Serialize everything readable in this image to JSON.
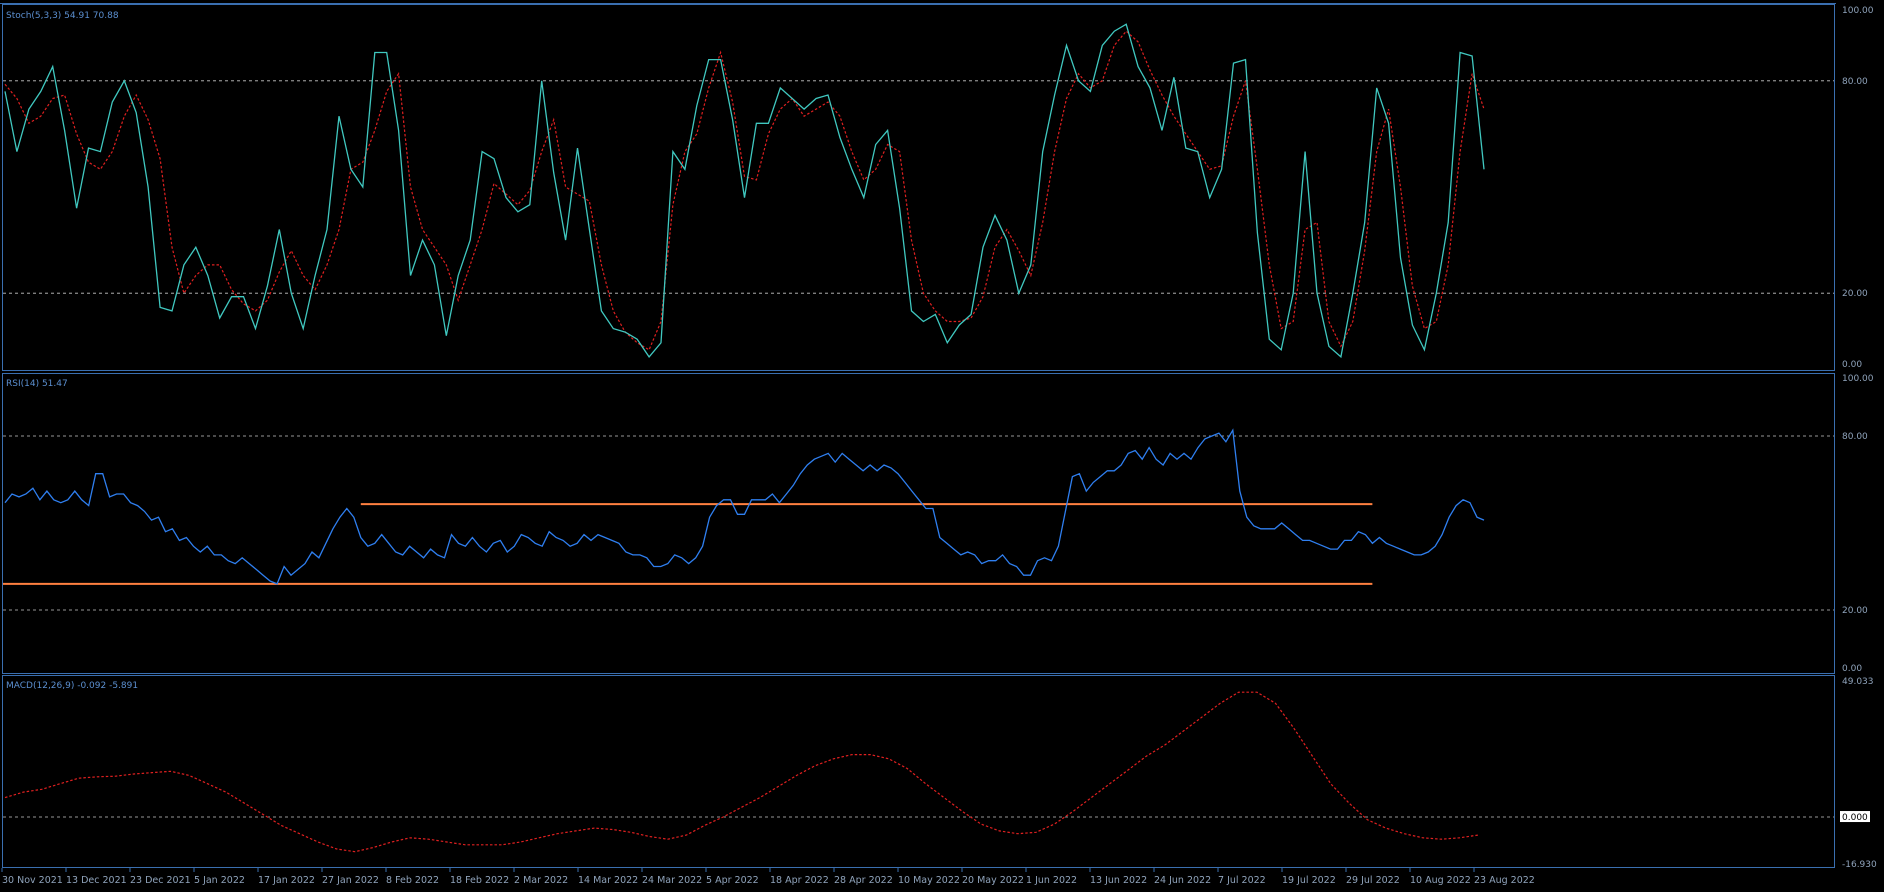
{
  "chart_data": [
    {
      "type": "line",
      "indicator_label": "Stoch(5,3,3) 54.91 70.88",
      "ylim": [
        0,
        100
      ],
      "levels": [
        20,
        80
      ],
      "y_ticks": [
        "100.00",
        "80.00",
        "20.00",
        "0.00"
      ],
      "colors": {
        "main": "#40c8c0",
        "signal": "#e02020",
        "level": "#c8c8c8"
      },
      "series": [
        {
          "values": [
            77,
            60,
            72,
            77,
            84,
            66,
            44,
            61,
            60,
            74,
            80,
            71,
            50,
            16,
            15,
            28,
            33,
            25,
            13,
            19,
            19,
            10,
            22,
            38,
            20,
            10,
            25,
            38,
            70,
            55,
            50,
            88,
            88,
            66,
            25,
            35,
            28,
            8,
            25,
            35,
            60,
            58,
            47,
            43,
            45,
            80,
            54,
            35,
            61,
            38,
            15,
            10,
            9,
            7,
            2,
            6,
            60,
            55,
            73,
            86,
            86,
            69,
            47,
            68,
            68,
            78,
            75,
            72,
            75,
            76,
            64,
            55,
            47,
            62,
            66,
            44,
            15,
            12,
            14,
            6,
            11,
            14,
            33,
            42,
            35,
            20,
            28,
            60,
            76,
            90,
            80,
            77,
            90,
            94,
            96,
            84,
            78,
            66,
            81,
            61,
            60,
            47,
            55,
            85,
            86,
            37,
            7,
            4,
            20,
            60,
            20,
            5,
            2,
            20,
            40,
            78,
            68,
            30,
            11,
            4,
            20,
            40,
            88,
            87,
            55
          ]
        },
        {
          "values": [
            79,
            75,
            68,
            70,
            75,
            76,
            65,
            57,
            55,
            60,
            70,
            76,
            69,
            58,
            33,
            20,
            25,
            28,
            28,
            21,
            17,
            15,
            18,
            26,
            32,
            25,
            21,
            28,
            38,
            55,
            57,
            66,
            77,
            82,
            50,
            38,
            33,
            28,
            18,
            28,
            38,
            51,
            48,
            45,
            49,
            60,
            69,
            50,
            48,
            46,
            28,
            15,
            9,
            6,
            4,
            12,
            45,
            60,
            65,
            78,
            88,
            74,
            53,
            52,
            65,
            72,
            75,
            70,
            72,
            74,
            70,
            60,
            52,
            55,
            62,
            60,
            35,
            20,
            15,
            12,
            12,
            13,
            19,
            33,
            38,
            32,
            25,
            40,
            60,
            75,
            82,
            78,
            80,
            90,
            94,
            91,
            83,
            76,
            70,
            65,
            60,
            55,
            56,
            70,
            80,
            55,
            28,
            10,
            12,
            38,
            40,
            12,
            5,
            12,
            32,
            60,
            72,
            50,
            22,
            10,
            12,
            28,
            60,
            82,
            72
          ]
        }
      ]
    },
    {
      "type": "line",
      "indicator_label": "RSI(14) 51.47",
      "ylim": [
        0,
        100
      ],
      "levels": [
        20,
        80
      ],
      "y_ticks": [
        "100.00",
        "80.00",
        "20.00",
        "0.00"
      ],
      "colors": {
        "main": "#2f7ff0",
        "trendline": "#ff8040",
        "level": "#c8c8c8"
      },
      "series": [
        {
          "values": [
            57,
            60,
            59,
            60,
            62,
            58,
            61,
            58,
            57,
            58,
            61,
            58,
            56,
            67,
            67,
            59,
            60,
            60,
            57,
            56,
            54,
            51,
            52,
            47,
            48,
            44,
            45,
            42,
            40,
            42,
            39,
            39,
            37,
            36,
            38,
            36,
            34,
            32,
            30,
            29,
            35,
            32,
            34,
            36,
            40,
            38,
            43,
            48,
            52,
            55,
            52,
            45,
            42,
            43,
            46,
            43,
            40,
            39,
            42,
            40,
            38,
            41,
            39,
            38,
            46,
            43,
            42,
            45,
            42,
            40,
            43,
            44,
            40,
            42,
            46,
            45,
            43,
            42,
            47,
            45,
            44,
            42,
            43,
            46,
            44,
            46,
            45,
            44,
            43,
            40,
            39,
            39,
            38,
            35,
            35,
            36,
            39,
            38,
            36,
            38,
            42,
            52,
            56,
            58,
            58,
            53,
            53,
            58,
            58,
            58,
            60,
            57,
            60,
            63,
            67,
            70,
            72,
            73,
            74,
            71,
            74,
            72,
            70,
            68,
            70,
            68,
            70,
            69,
            67,
            64,
            61,
            58,
            55,
            55,
            45,
            43,
            41,
            39,
            40,
            39,
            36,
            37,
            37,
            39,
            36,
            35,
            32,
            32,
            37,
            38,
            37,
            42,
            54,
            66,
            67,
            61,
            64,
            66,
            68,
            68,
            70,
            74,
            75,
            72,
            76,
            72,
            70,
            74,
            72,
            74,
            72,
            76,
            79,
            80,
            81,
            78,
            82,
            61,
            52,
            49,
            48,
            48,
            48,
            50,
            48,
            46,
            44,
            44,
            43,
            42,
            41,
            41,
            44,
            44,
            47,
            46,
            43,
            45,
            43,
            42,
            41,
            40,
            39,
            39,
            40,
            42,
            46,
            52,
            56,
            58,
            57,
            52,
            51
          ]
        }
      ],
      "trendlines": [
        {
          "x": [
            0,
            196
          ],
          "values": [
            29,
            29
          ]
        },
        {
          "x": [
            51,
            196
          ],
          "values": [
            56.5,
            56.5
          ]
        }
      ]
    },
    {
      "type": "line",
      "indicator_label": "MACD(12,26,9) -0.092 -5.891",
      "ylim": [
        -16.93,
        49.033
      ],
      "levels": [
        0
      ],
      "y_ticks": [
        "49.033",
        "0.000",
        "-16.930"
      ],
      "colors": {
        "signal": "#e02020",
        "level": "#c8c8c8"
      },
      "series": [
        {
          "values": [
            7,
            9,
            10,
            12,
            14,
            14.5,
            14.7,
            15.5,
            16,
            16.5,
            15,
            12,
            9,
            5,
            1,
            -3,
            -6,
            -9,
            -11.5,
            -12.5,
            -11,
            -9,
            -7.5,
            -8,
            -9,
            -10,
            -10,
            -10,
            -9,
            -7.5,
            -6,
            -5,
            -4,
            -4.5,
            -5.5,
            -7,
            -8,
            -6.5,
            -3,
            0,
            3.5,
            7,
            11,
            15,
            18.5,
            21,
            22.5,
            22.5,
            21,
            17.5,
            12,
            7,
            2,
            -2.5,
            -5,
            -6,
            -5.5,
            -2.5,
            2,
            7,
            12,
            17,
            22,
            26,
            31,
            36,
            41,
            45,
            45,
            41,
            32,
            22,
            12,
            5,
            -1,
            -4,
            -6,
            -7.5,
            -8,
            -7.5,
            -6.5
          ]
        }
      ]
    }
  ],
  "x_labels": [
    "30 Nov 2021",
    "13 Dec 2021",
    "23 Dec 2021",
    "5 Jan 2022",
    "17 Jan 2022",
    "27 Jan 2022",
    "8 Feb 2022",
    "18 Feb 2022",
    "2 Mar 2022",
    "14 Mar 2022",
    "24 Mar 2022",
    "5 Apr 2022",
    "18 Apr 2022",
    "28 Apr 2022",
    "10 May 2022",
    "20 May 2022",
    "1 Jun 2022",
    "13 Jun 2022",
    "24 Jun 2022",
    "7 Jul 2022",
    "19 Jul 2022",
    "29 Jul 2022",
    "10 Aug 2022",
    "23 Aug 2022"
  ]
}
